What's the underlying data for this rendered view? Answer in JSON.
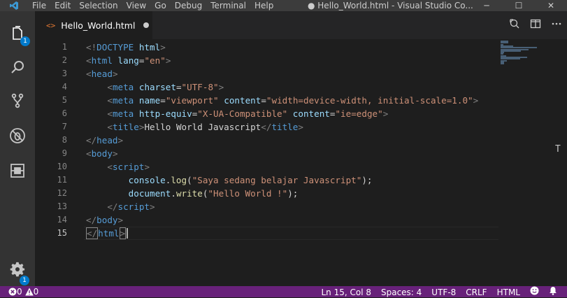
{
  "titlebar": {
    "menu": [
      "File",
      "Edit",
      "Selection",
      "View",
      "Go",
      "Debug",
      "Terminal",
      "Help"
    ],
    "window_title": "● Hello_World.html - Visual Studio Co...",
    "minimize": "─",
    "maximize": "☐",
    "close": "✕"
  },
  "activity": {
    "explorer_badge": "1",
    "settings_badge": "1"
  },
  "tab": {
    "icon": "<>",
    "filename": "Hello_World.html"
  },
  "editor": {
    "line_numbers": [
      "1",
      "2",
      "3",
      "4",
      "5",
      "6",
      "7",
      "8",
      "9",
      "10",
      "11",
      "12",
      "13",
      "14",
      "15"
    ],
    "lines": [
      [
        [
          "b",
          "<!"
        ],
        [
          "t",
          "DOCTYPE"
        ],
        [
          "x",
          " "
        ],
        [
          "a",
          "html"
        ],
        [
          "b",
          ">"
        ]
      ],
      [
        [
          "b",
          "<"
        ],
        [
          "t",
          "html"
        ],
        [
          "x",
          " "
        ],
        [
          "a",
          "lang"
        ],
        [
          "x",
          "="
        ],
        [
          "s",
          "\"en\""
        ],
        [
          "b",
          ">"
        ]
      ],
      [
        [
          "b",
          "<"
        ],
        [
          "t",
          "head"
        ],
        [
          "b",
          ">"
        ]
      ],
      [
        [
          "x",
          "    "
        ],
        [
          "b",
          "<"
        ],
        [
          "t",
          "meta"
        ],
        [
          "x",
          " "
        ],
        [
          "a",
          "charset"
        ],
        [
          "x",
          "="
        ],
        [
          "s",
          "\"UTF-8\""
        ],
        [
          "b",
          ">"
        ]
      ],
      [
        [
          "x",
          "    "
        ],
        [
          "b",
          "<"
        ],
        [
          "t",
          "meta"
        ],
        [
          "x",
          " "
        ],
        [
          "a",
          "name"
        ],
        [
          "x",
          "="
        ],
        [
          "s",
          "\"viewport\""
        ],
        [
          "x",
          " "
        ],
        [
          "a",
          "content"
        ],
        [
          "x",
          "="
        ],
        [
          "s",
          "\"width=device-width, initial-scale=1.0\""
        ],
        [
          "b",
          ">"
        ]
      ],
      [
        [
          "x",
          "    "
        ],
        [
          "b",
          "<"
        ],
        [
          "t",
          "meta"
        ],
        [
          "x",
          " "
        ],
        [
          "a",
          "http-equiv"
        ],
        [
          "x",
          "="
        ],
        [
          "s",
          "\"X-UA-Compatible\""
        ],
        [
          "x",
          " "
        ],
        [
          "a",
          "content"
        ],
        [
          "x",
          "="
        ],
        [
          "s",
          "\"ie=edge\""
        ],
        [
          "b",
          ">"
        ]
      ],
      [
        [
          "x",
          "    "
        ],
        [
          "b",
          "<"
        ],
        [
          "t",
          "title"
        ],
        [
          "b",
          ">"
        ],
        [
          "x",
          "Hello World Javascript"
        ],
        [
          "b",
          "</"
        ],
        [
          "t",
          "title"
        ],
        [
          "b",
          ">"
        ]
      ],
      [
        [
          "b",
          "</"
        ],
        [
          "t",
          "head"
        ],
        [
          "b",
          ">"
        ]
      ],
      [
        [
          "b",
          "<"
        ],
        [
          "t",
          "body"
        ],
        [
          "b",
          ">"
        ]
      ],
      [
        [
          "x",
          "    "
        ],
        [
          "b",
          "<"
        ],
        [
          "t",
          "script"
        ],
        [
          "b",
          ">"
        ]
      ],
      [
        [
          "x",
          "        "
        ],
        [
          "v",
          "console"
        ],
        [
          "x",
          "."
        ],
        [
          "f",
          "log"
        ],
        [
          "x",
          "("
        ],
        [
          "s",
          "\"Saya sedang belajar Javascript\""
        ],
        [
          "x",
          ");"
        ]
      ],
      [
        [
          "x",
          "        "
        ],
        [
          "v",
          "document"
        ],
        [
          "x",
          "."
        ],
        [
          "f",
          "write"
        ],
        [
          "x",
          "("
        ],
        [
          "s",
          "\"Hello World !\""
        ],
        [
          "x",
          ");"
        ]
      ],
      [
        [
          "x",
          "    "
        ],
        [
          "b",
          "</"
        ],
        [
          "t",
          "script"
        ],
        [
          "b",
          ">"
        ]
      ],
      [
        [
          "b",
          "</"
        ],
        [
          "t",
          "body"
        ],
        [
          "b",
          ">"
        ]
      ],
      [
        [
          "b",
          "</"
        ],
        [
          "t",
          "html"
        ],
        [
          "b",
          ">"
        ]
      ]
    ],
    "scroll_marker": "T"
  },
  "statusbar": {
    "errors": "0",
    "warnings": "0",
    "position": "Ln 15, Col 8",
    "spaces": "Spaces: 4",
    "encoding": "UTF-8",
    "eol": "CRLF",
    "language": "HTML"
  }
}
